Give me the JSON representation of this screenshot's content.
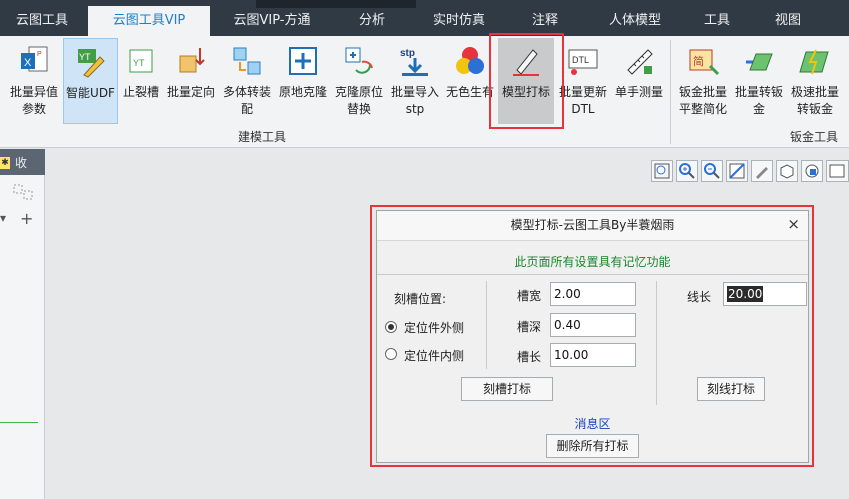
{
  "tabs": [
    {
      "label": "云图工具",
      "active": false
    },
    {
      "label": "云图工具VIP",
      "active": true
    },
    {
      "label": "云图VIP-方通",
      "active": false
    },
    {
      "label": "分析",
      "active": false
    },
    {
      "label": "实时仿真",
      "active": false
    },
    {
      "label": "注释",
      "active": false
    },
    {
      "label": "人体模型",
      "active": false
    },
    {
      "label": "工具",
      "active": false
    },
    {
      "label": "视图",
      "active": false
    }
  ],
  "ribbon": {
    "buttons": [
      {
        "label": "批量异值\n参数",
        "icon": "excel-params-icon"
      },
      {
        "label": "智能UDF",
        "icon": "udf-icon",
        "selected": true
      },
      {
        "label": "止裂槽",
        "icon": "relief-slot-icon"
      },
      {
        "label": "批量定向",
        "icon": "batch-orient-icon"
      },
      {
        "label": "多体转装\n配",
        "icon": "multibody-assembly-icon"
      },
      {
        "label": "原地克隆",
        "icon": "clone-in-place-icon"
      },
      {
        "label": "克隆原位\n替换",
        "icon": "clone-replace-icon"
      },
      {
        "label": "批量导入\nstp",
        "icon": "import-stp-icon"
      },
      {
        "label": "无色生有",
        "icon": "color-circles-icon"
      },
      {
        "label": "模型打标",
        "icon": "model-mark-icon",
        "highlighted": true
      },
      {
        "label": "批量更新\nDTL",
        "icon": "update-dtl-icon"
      },
      {
        "label": "单手测量",
        "icon": "measure-icon"
      },
      {
        "label": "钣金批量\n平整简化",
        "icon": "sheetmetal-simplify-icon"
      },
      {
        "label": "批量转钣\n金",
        "icon": "convert-sheetmetal-icon"
      },
      {
        "label": "极速批量\n转钣金",
        "icon": "fast-convert-icon"
      }
    ],
    "group_modeling": "建模工具",
    "group_sheetmetal": "钣金工具"
  },
  "left_panel": {
    "header_text": "收"
  },
  "dialog": {
    "title": "模型打标-云图工具By半蓑烟雨",
    "close": "×",
    "notice": "此页面所有设置具有记忆功能",
    "slot_position_label": "刻槽位置:",
    "radio_outside": "定位件外侧",
    "radio_inside": "定位件内侧",
    "slot_width_label": "槽宽",
    "slot_width_value": "2.00",
    "slot_depth_label": "槽深",
    "slot_depth_value": "0.40",
    "slot_length_label": "槽长",
    "slot_length_value": "10.00",
    "line_length_label": "线长",
    "line_length_value": "20.00",
    "slot_mark_button": "刻槽打标",
    "line_mark_button": "刻线打标",
    "message_area": "消息区",
    "delete_all_button": "删除所有打标"
  },
  "colors": {
    "accent_red": "#e8323c",
    "tab_active": "#1f7fc9",
    "notice_green": "#19862d",
    "message_blue": "#1a3fbf"
  }
}
